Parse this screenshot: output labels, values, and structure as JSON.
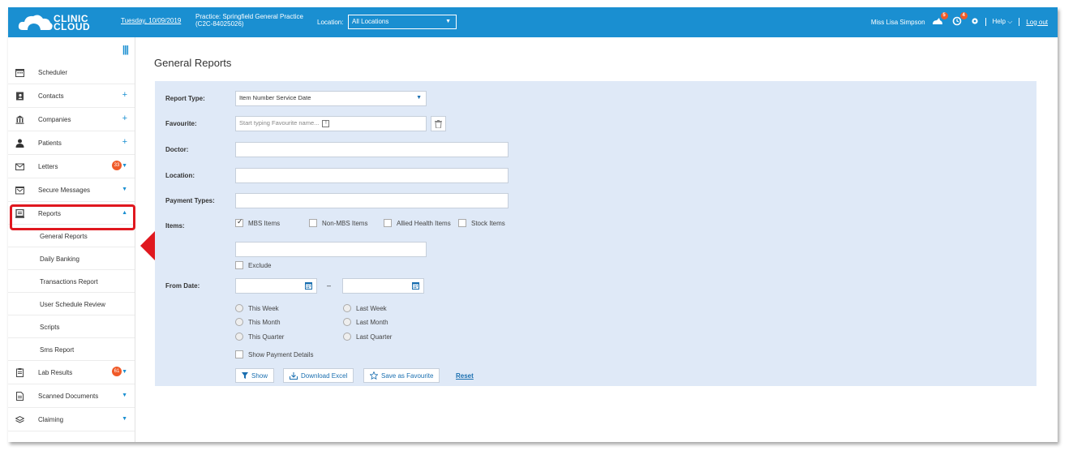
{
  "header": {
    "logo_text_1": "CLINIC",
    "logo_text_2": "CLOUD",
    "date": "Tuesday, 10/09/2019",
    "practice_line1": "Practice: Springfield General Practice",
    "practice_line2": "(C2C-84025026)",
    "location_label": "Location:",
    "location_value": "All Locations",
    "user_name": "Miss Lisa Simpson",
    "notif_count_1": "5",
    "notif_count_2": "4",
    "help_label": "Help",
    "logout_label": "Log out"
  },
  "sidebar": {
    "items": [
      {
        "label": "Scheduler"
      },
      {
        "label": "Contacts"
      },
      {
        "label": "Companies"
      },
      {
        "label": "Patients"
      },
      {
        "label": "Letters",
        "count": "33"
      },
      {
        "label": "Secure Messages"
      },
      {
        "label": "Reports"
      },
      {
        "label": "Lab Results",
        "count": "61"
      },
      {
        "label": "Scanned Documents"
      },
      {
        "label": "Claiming"
      }
    ],
    "sub_items": [
      {
        "label": "General Reports"
      },
      {
        "label": "Daily Banking"
      },
      {
        "label": "Transactions Report"
      },
      {
        "label": "User Schedule Review"
      },
      {
        "label": "Scripts"
      },
      {
        "label": "Sms Report"
      }
    ]
  },
  "main": {
    "title": "General Reports",
    "labels": {
      "report_type": "Report Type:",
      "favourite": "Favourite:",
      "doctor": "Doctor:",
      "location": "Location:",
      "payment_types": "Payment Types:",
      "items": "Items:",
      "from_date": "From Date:"
    },
    "report_type_value": "Item Number Service Date",
    "favourite_placeholder": "Start typing Favourite name...",
    "items_options": [
      {
        "label": "MBS Items",
        "checked": true
      },
      {
        "label": "Non-MBS Items",
        "checked": false
      },
      {
        "label": "Allied Health Items",
        "checked": false
      },
      {
        "label": "Stock Items",
        "checked": false
      }
    ],
    "exclude_label": "Exclude",
    "date_separator": "–",
    "radios_left": [
      "This Week",
      "This Month",
      "This Quarter"
    ],
    "radios_right": [
      "Last Week",
      "Last Month",
      "Last Quarter"
    ],
    "show_payment_details": "Show Payment Details",
    "buttons": {
      "show": "Show",
      "download_excel": "Download Excel",
      "save_favourite": "Save as Favourite",
      "reset": "Reset"
    }
  },
  "colors": {
    "topbar": "#1a8fd1",
    "panel": "#dfe9f7",
    "badge": "#f05a28",
    "highlight": "#e0181f"
  }
}
